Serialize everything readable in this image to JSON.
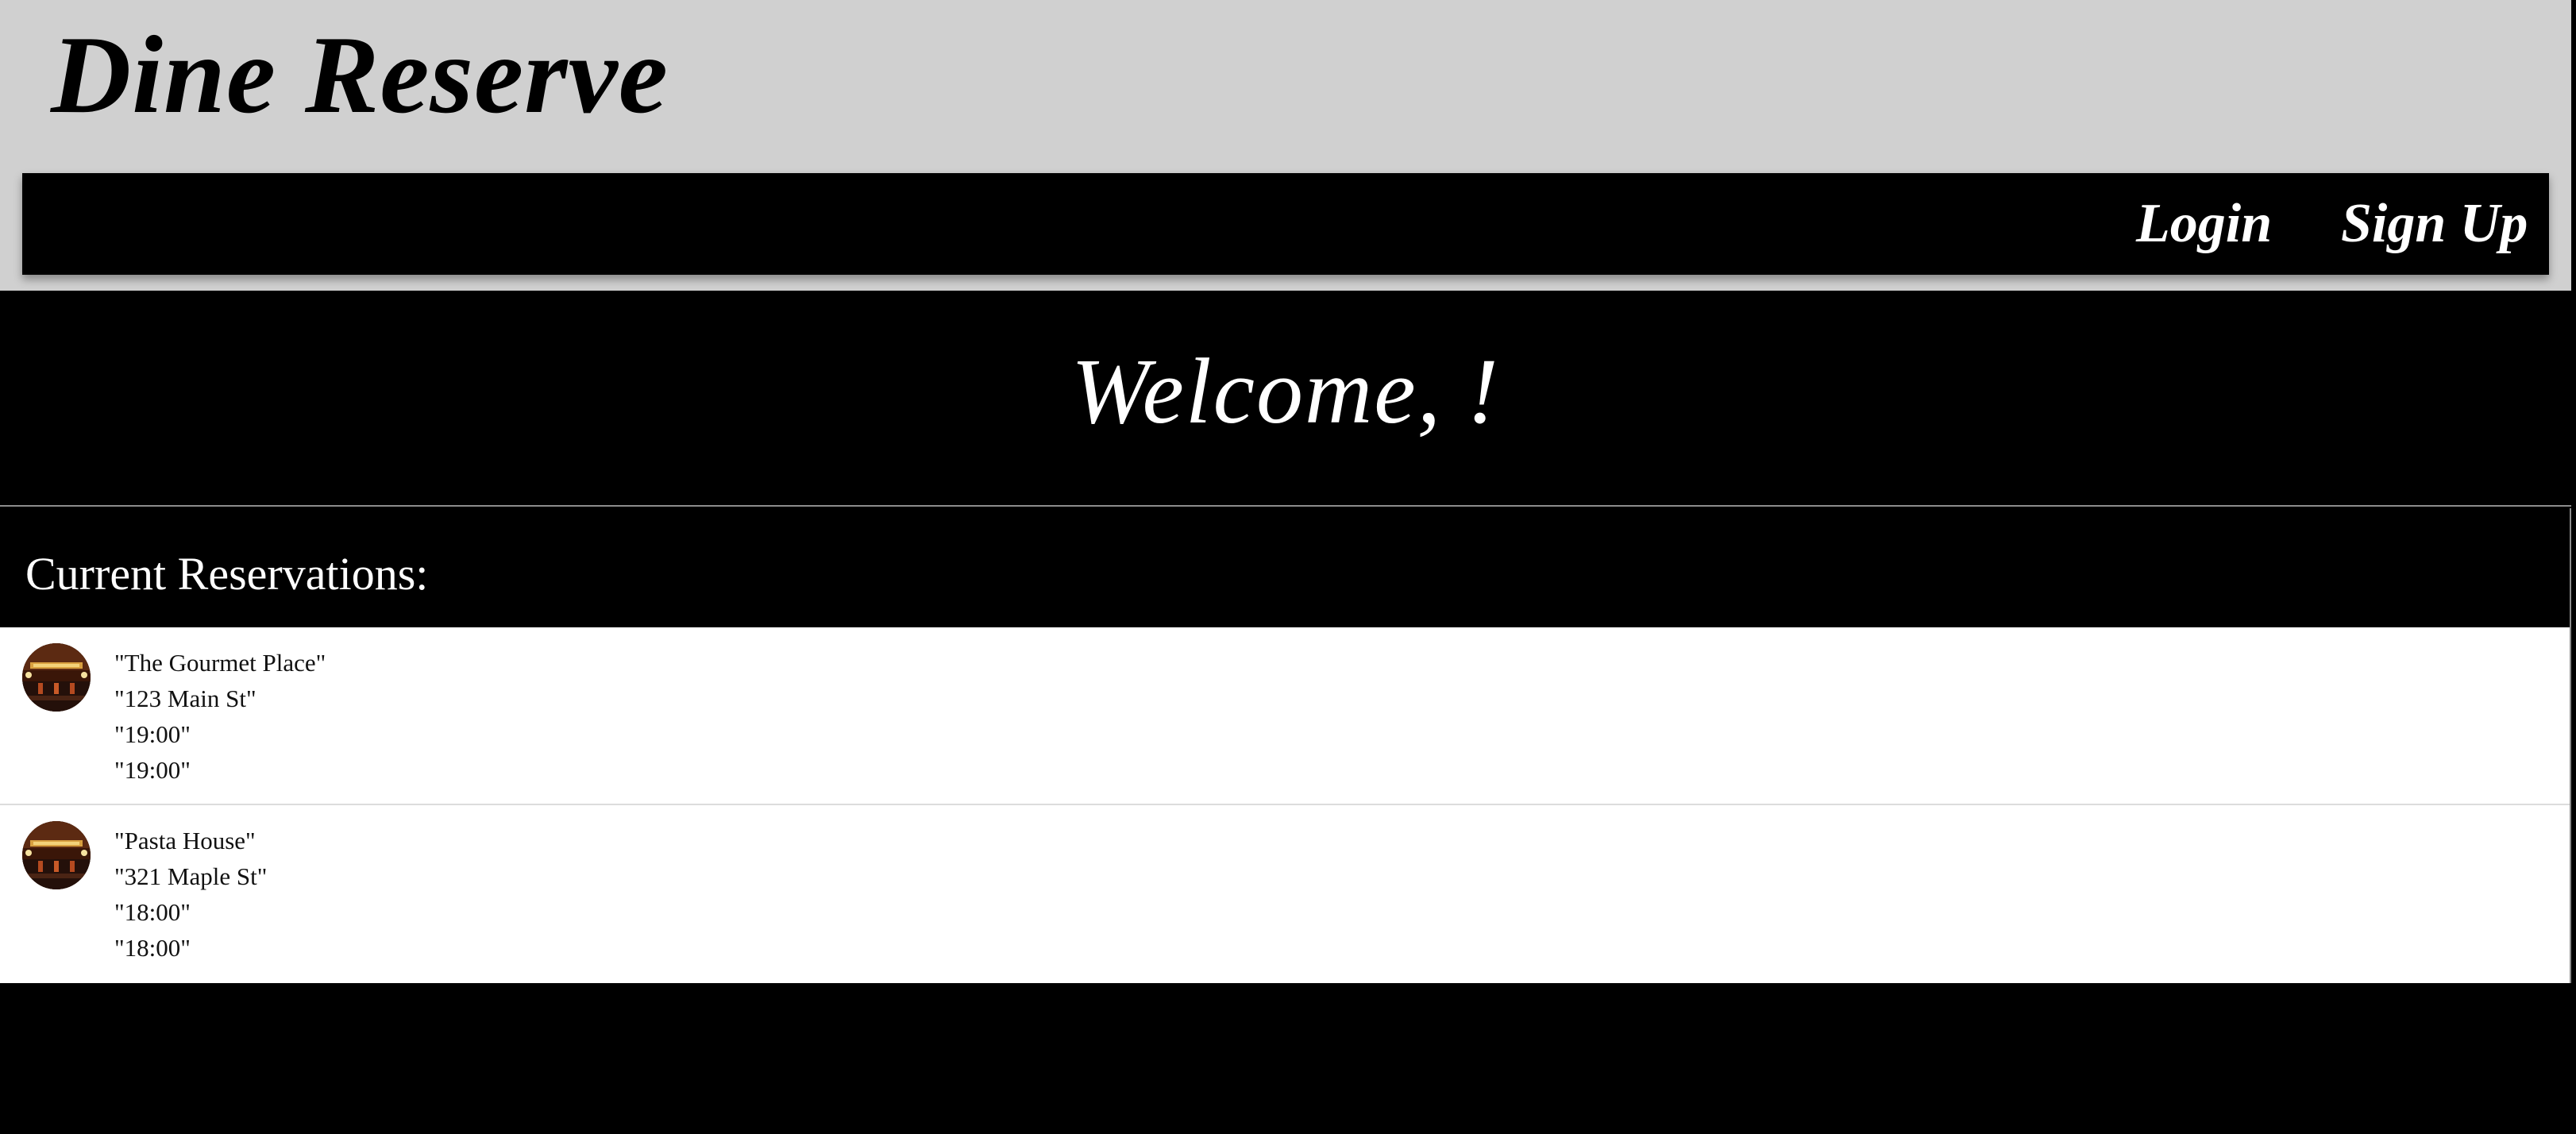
{
  "header": {
    "brand": "Dine Reserve",
    "nav": {
      "login_label": "Login",
      "signup_label": "Sign Up"
    }
  },
  "welcome": {
    "title": "Welcome, !"
  },
  "reservations": {
    "heading": "Current Reservations:",
    "items": [
      {
        "name": "\"The Gourmet Place\"",
        "address": "\"123 Main St\"",
        "time": "\"19:00\"",
        "time_repeat": "\"19:00\"",
        "image_icon": "restaurant-thumbnail-icon"
      },
      {
        "name": "\"Pasta House\"",
        "address": "\"321 Maple St\"",
        "time": "\"18:00\"",
        "time_repeat": "\"18:00\"",
        "image_icon": "restaurant-thumbnail-icon"
      }
    ]
  },
  "colors": {
    "header_bg": "#d0d0d0",
    "nav_bg": "#000000",
    "page_bg": "#000000",
    "list_bg": "#ffffff",
    "text_light": "#ffffff",
    "text_dark": "#111111"
  }
}
